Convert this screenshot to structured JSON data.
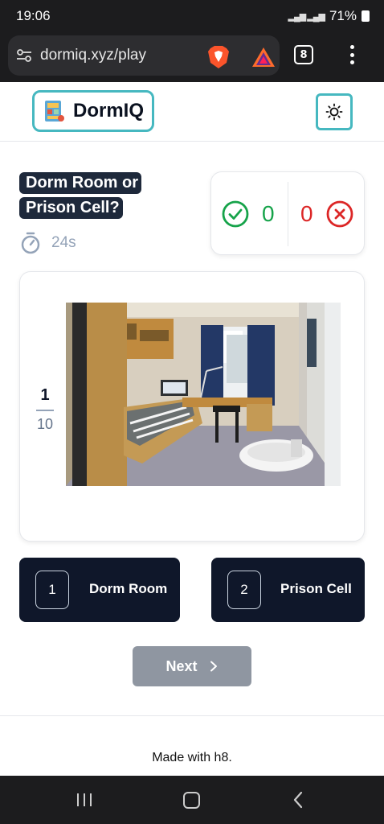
{
  "status_bar": {
    "time": "19:06",
    "battery": "71%"
  },
  "browser": {
    "url": "dormiq.xyz/play",
    "tab_count": "8"
  },
  "header": {
    "app_name": "DormIQ"
  },
  "question": {
    "title": "Dorm Room or Prison Cell?",
    "timer": "24s"
  },
  "score": {
    "correct": "0",
    "wrong": "0"
  },
  "progress": {
    "current": "1",
    "total": "10"
  },
  "answers": [
    {
      "key": "1",
      "label": "Dorm Room"
    },
    {
      "key": "2",
      "label": "Prison Cell"
    }
  ],
  "next_label": "Next",
  "footer": "Made with h8.",
  "colors": {
    "accent": "#46b8c0",
    "button_dark": "#0f172a",
    "correct": "#16a34a",
    "wrong": "#dc2626",
    "disabled": "#8f96a1"
  }
}
